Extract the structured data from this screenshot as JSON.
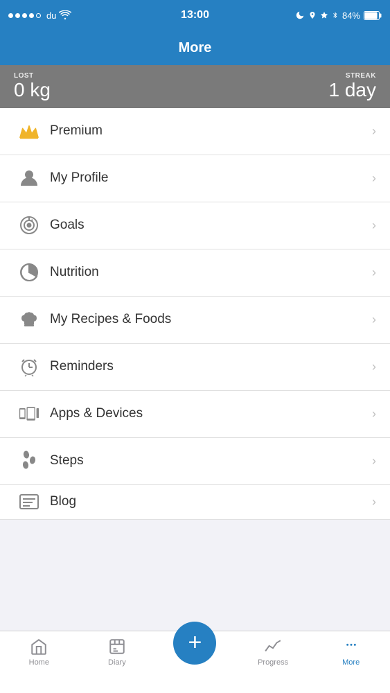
{
  "statusBar": {
    "carrier": "du",
    "time": "13:00",
    "battery": "84%"
  },
  "header": {
    "title": "More"
  },
  "stats": {
    "lostLabel": "LOST",
    "lostValue": "0 kg",
    "streakLabel": "STREAK",
    "streakValue": "1 day"
  },
  "menuItems": [
    {
      "id": "premium",
      "label": "Premium",
      "icon": "crown"
    },
    {
      "id": "my-profile",
      "label": "My Profile",
      "icon": "person"
    },
    {
      "id": "goals",
      "label": "Goals",
      "icon": "target"
    },
    {
      "id": "nutrition",
      "label": "Nutrition",
      "icon": "pie-chart"
    },
    {
      "id": "my-recipes",
      "label": "My Recipes & Foods",
      "icon": "chef-hat"
    },
    {
      "id": "reminders",
      "label": "Reminders",
      "icon": "alarm"
    },
    {
      "id": "apps-devices",
      "label": "Apps & Devices",
      "icon": "devices"
    },
    {
      "id": "steps",
      "label": "Steps",
      "icon": "footsteps"
    },
    {
      "id": "blog",
      "label": "Blog",
      "icon": "blog"
    }
  ],
  "tabBar": {
    "items": [
      {
        "id": "home",
        "label": "Home",
        "icon": "home"
      },
      {
        "id": "diary",
        "label": "Diary",
        "icon": "diary"
      },
      {
        "id": "add",
        "label": "+",
        "icon": "plus"
      },
      {
        "id": "progress",
        "label": "Progress",
        "icon": "progress"
      },
      {
        "id": "more",
        "label": "More",
        "icon": "more"
      }
    ]
  }
}
